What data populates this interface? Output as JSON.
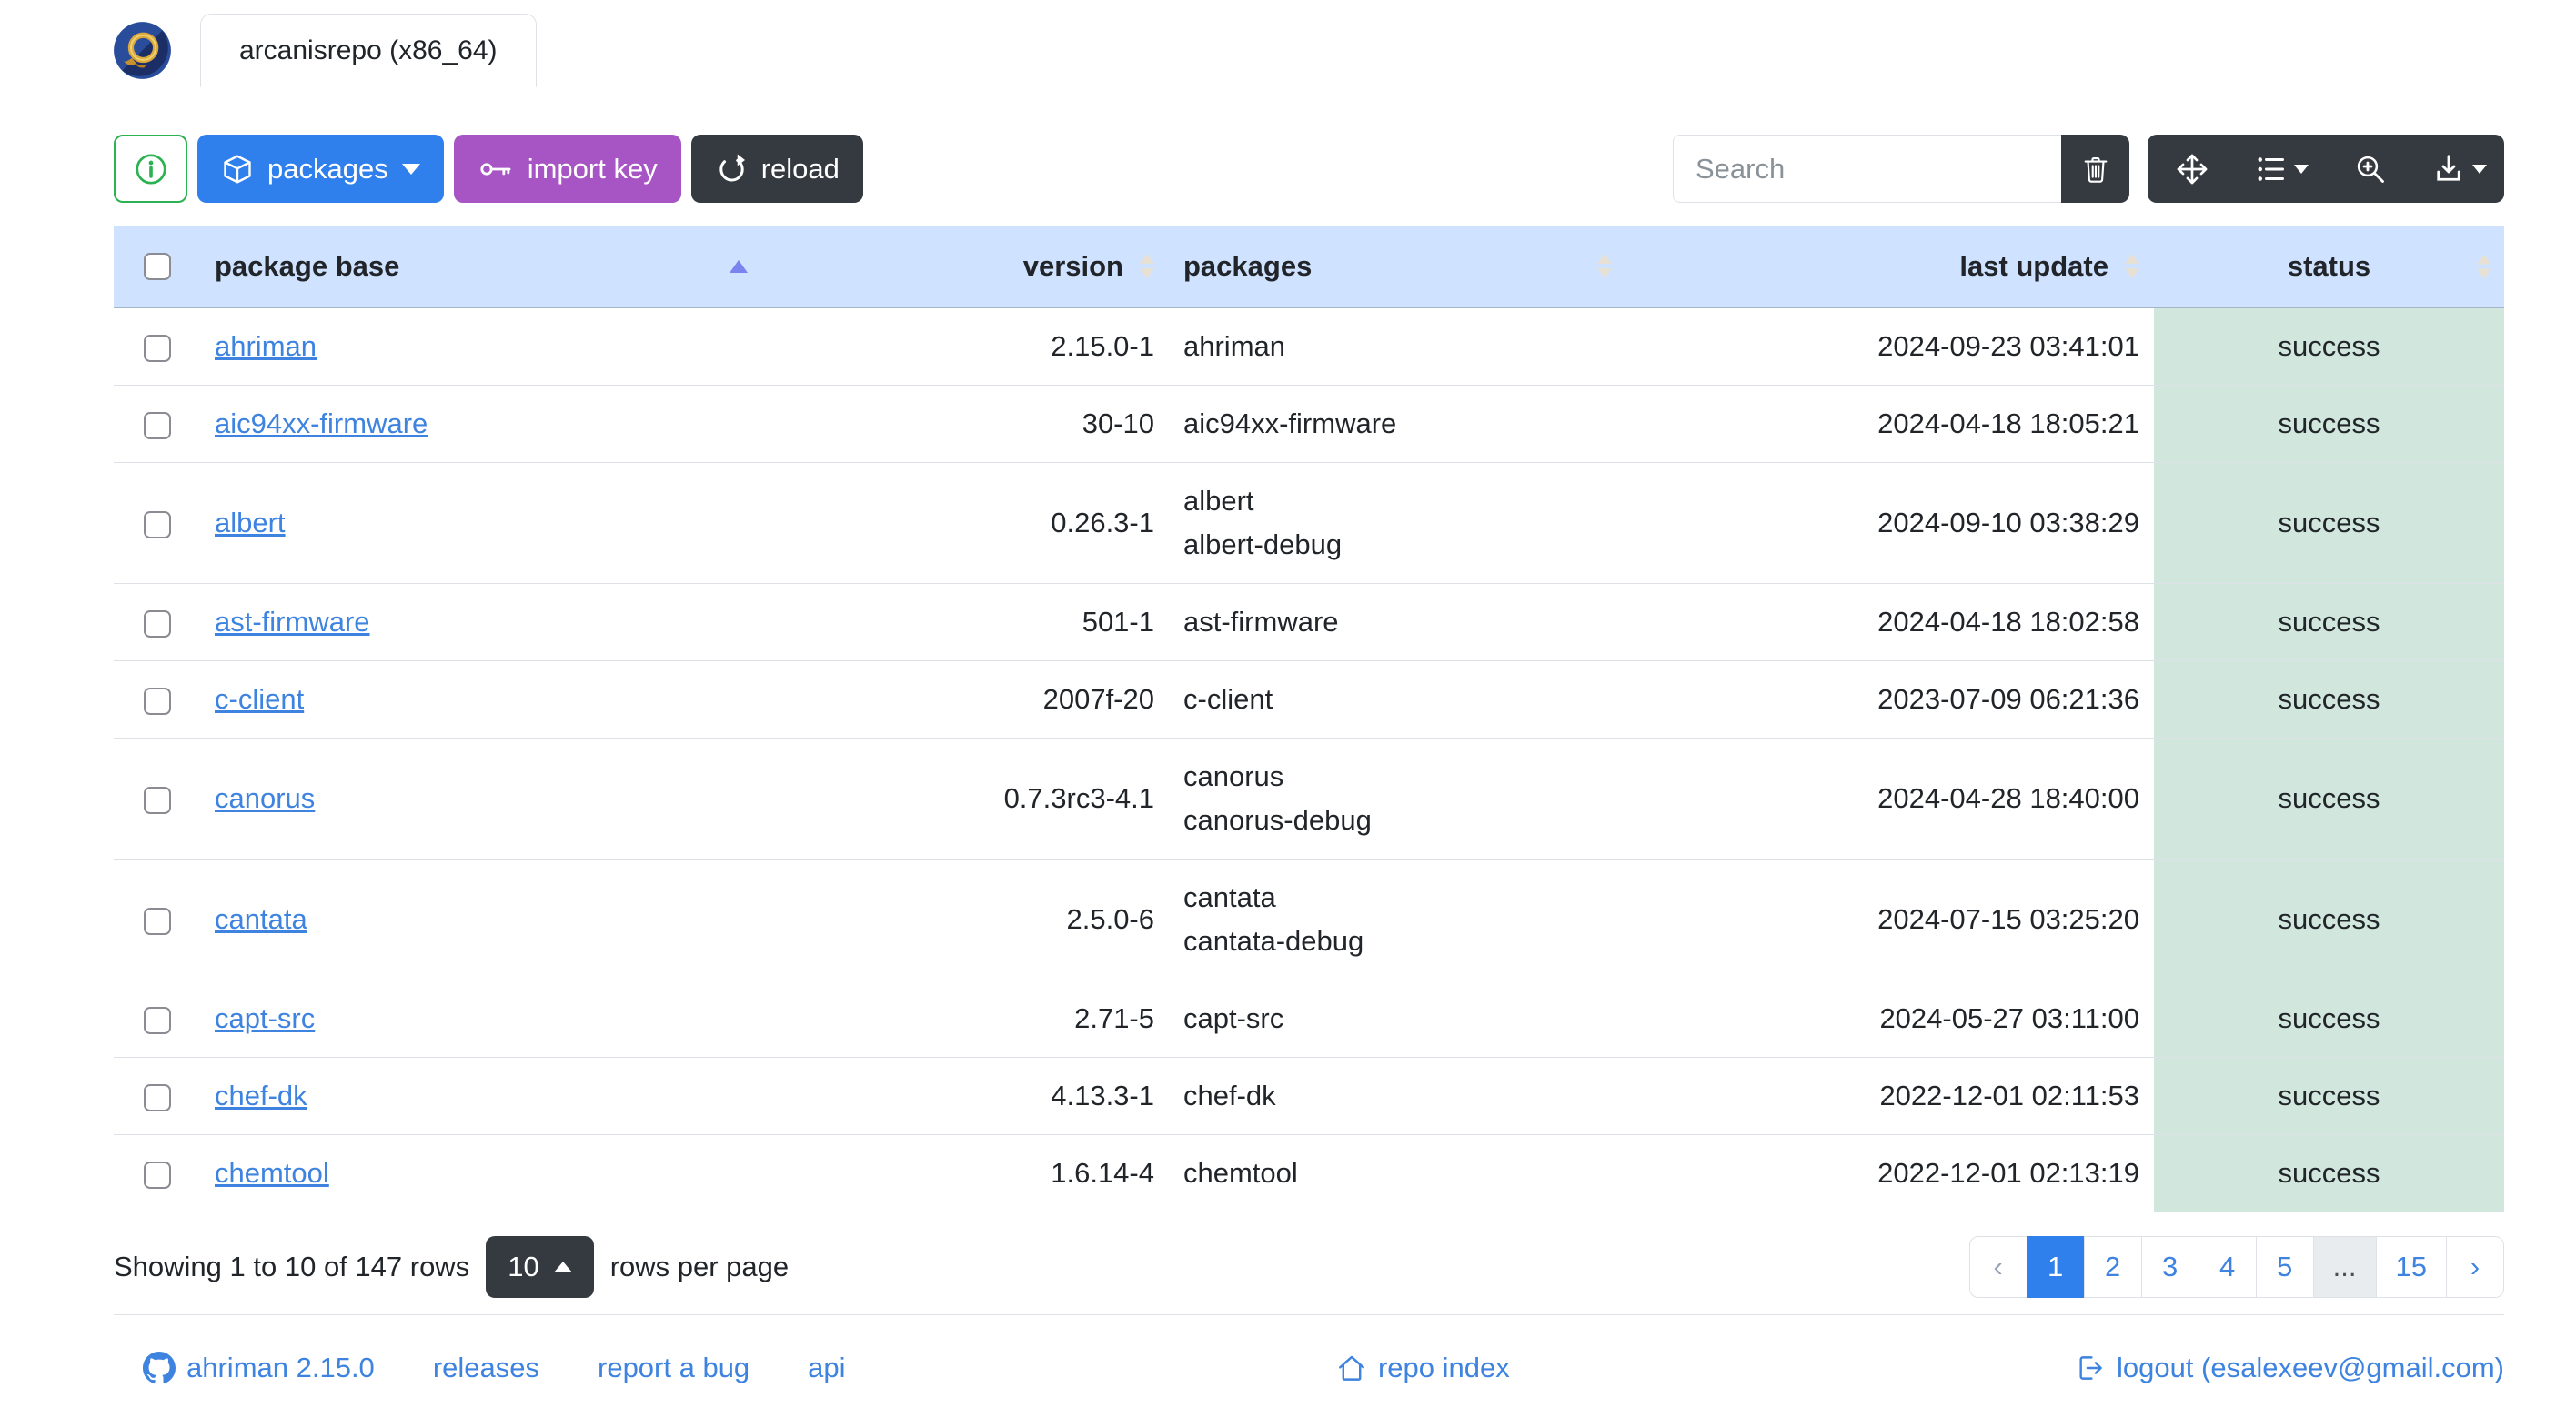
{
  "window": {
    "tab_label": "arcanisrepo (x86_64)"
  },
  "toolbar": {
    "packages_label": "packages",
    "import_key_label": "import key",
    "reload_label": "reload",
    "search_placeholder": "Search"
  },
  "table": {
    "headers": [
      "package base",
      "version",
      "packages",
      "last update",
      "status"
    ],
    "sort": {
      "column": "package base",
      "direction": "asc"
    },
    "rows": [
      {
        "base": "ahriman",
        "version": "2.15.0-1",
        "packages": [
          "ahriman"
        ],
        "last_update": "2024-09-23 03:41:01",
        "status": "success"
      },
      {
        "base": "aic94xx-firmware",
        "version": "30-10",
        "packages": [
          "aic94xx-firmware"
        ],
        "last_update": "2024-04-18 18:05:21",
        "status": "success"
      },
      {
        "base": "albert",
        "version": "0.26.3-1",
        "packages": [
          "albert",
          "albert-debug"
        ],
        "last_update": "2024-09-10 03:38:29",
        "status": "success"
      },
      {
        "base": "ast-firmware",
        "version": "501-1",
        "packages": [
          "ast-firmware"
        ],
        "last_update": "2024-04-18 18:02:58",
        "status": "success"
      },
      {
        "base": "c-client",
        "version": "2007f-20",
        "packages": [
          "c-client"
        ],
        "last_update": "2023-07-09 06:21:36",
        "status": "success"
      },
      {
        "base": "canorus",
        "version": "0.7.3rc3-4.1",
        "packages": [
          "canorus",
          "canorus-debug"
        ],
        "last_update": "2024-04-28 18:40:00",
        "status": "success"
      },
      {
        "base": "cantata",
        "version": "2.5.0-6",
        "packages": [
          "cantata",
          "cantata-debug"
        ],
        "last_update": "2024-07-15 03:25:20",
        "status": "success"
      },
      {
        "base": "capt-src",
        "version": "2.71-5",
        "packages": [
          "capt-src"
        ],
        "last_update": "2024-05-27 03:11:00",
        "status": "success"
      },
      {
        "base": "chef-dk",
        "version": "4.13.3-1",
        "packages": [
          "chef-dk"
        ],
        "last_update": "2022-12-01 02:11:53",
        "status": "success"
      },
      {
        "base": "chemtool",
        "version": "1.6.14-4",
        "packages": [
          "chemtool"
        ],
        "last_update": "2022-12-01 02:13:19",
        "status": "success"
      }
    ]
  },
  "pagination": {
    "info": "Showing 1 to 10 of 147 rows",
    "page_size": "10",
    "rows_per_page_label": "rows per page",
    "prev": "‹",
    "next": "›",
    "pages": [
      "1",
      "2",
      "3",
      "4",
      "5",
      "...",
      "15"
    ],
    "active_page": "1"
  },
  "footer": {
    "version_link": "ahriman 2.15.0",
    "releases_link": "releases",
    "report_bug_link": "report a bug",
    "api_link": "api",
    "repo_index_link": "repo index",
    "logout_link": "logout (esalexeev@gmail.com)"
  },
  "icons": {
    "logo": "ahriman-logo",
    "info": "info-circle",
    "packages": "box",
    "import_key": "key",
    "reload": "arrow-clockwise",
    "clear_search": "trash",
    "move": "arrows-move",
    "columns": "list",
    "fullscreen": "zoom-in",
    "export": "download",
    "github": "github",
    "repo_index": "house",
    "logout": "box-arrow-right"
  },
  "colors": {
    "primary_blue": "#2f80ed",
    "purple": "#a755c4",
    "dark": "#343a40",
    "outline_green": "#2cb252",
    "header_blue_bg": "#cfe2ff",
    "success_green_bg": "#d1e7dd",
    "link_blue": "#3d83df",
    "sort_active": "#7b83ee"
  }
}
